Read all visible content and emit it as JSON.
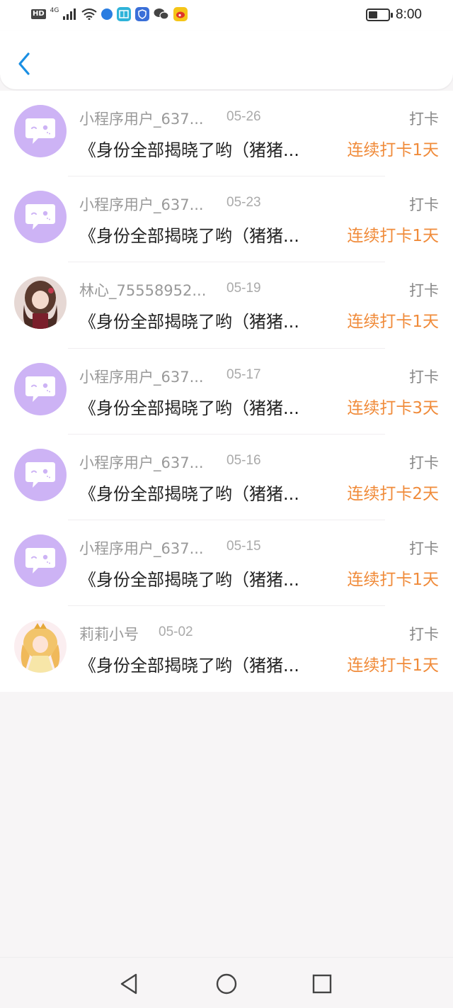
{
  "status_bar": {
    "hd": "HD",
    "network": "4G",
    "time": "8:00",
    "battery_level": 0.45,
    "icons": [
      "signal-icon",
      "wifi-icon",
      "blue-app-icon",
      "book-app-icon",
      "shield-app-icon",
      "wechat-icon",
      "weibo-icon"
    ]
  },
  "header": {
    "back_icon": "back-chevron-icon",
    "accent_color": "#1a8fe3"
  },
  "entries": [
    {
      "name": "小程序用户_637...",
      "date": "05-26",
      "type": "打卡",
      "title": "《身份全部揭晓了哟（猪猪...",
      "streak": "连续打卡1天",
      "avatar": "default-bubble"
    },
    {
      "name": "小程序用户_637...",
      "date": "05-23",
      "type": "打卡",
      "title": "《身份全部揭晓了哟（猪猪...",
      "streak": "连续打卡1天",
      "avatar": "default-bubble"
    },
    {
      "name": "林心_75558952...",
      "date": "05-19",
      "type": "打卡",
      "title": "《身份全部揭晓了哟（猪猪...",
      "streak": "连续打卡1天",
      "avatar": "photo-dark-hair-girl"
    },
    {
      "name": "小程序用户_637...",
      "date": "05-17",
      "type": "打卡",
      "title": "《身份全部揭晓了哟（猪猪...",
      "streak": "连续打卡3天",
      "avatar": "default-bubble"
    },
    {
      "name": "小程序用户_637...",
      "date": "05-16",
      "type": "打卡",
      "title": "《身份全部揭晓了哟（猪猪...",
      "streak": "连续打卡2天",
      "avatar": "default-bubble"
    },
    {
      "name": "小程序用户_637...",
      "date": "05-15",
      "type": "打卡",
      "title": "《身份全部揭晓了哟（猪猪...",
      "streak": "连续打卡1天",
      "avatar": "default-bubble"
    },
    {
      "name": "莉莉小号",
      "date": "05-02",
      "type": "打卡",
      "title": "《身份全部揭晓了哟（猪猪...",
      "streak": "连续打卡1天",
      "avatar": "photo-blonde-girl"
    }
  ],
  "colors": {
    "streak": "#f08b3a",
    "default_avatar": "#cdb3f5",
    "page_background": "#f7f5f6"
  },
  "nav_bar": {
    "icons": [
      "nav-back-icon",
      "nav-home-icon",
      "nav-recents-icon"
    ]
  }
}
